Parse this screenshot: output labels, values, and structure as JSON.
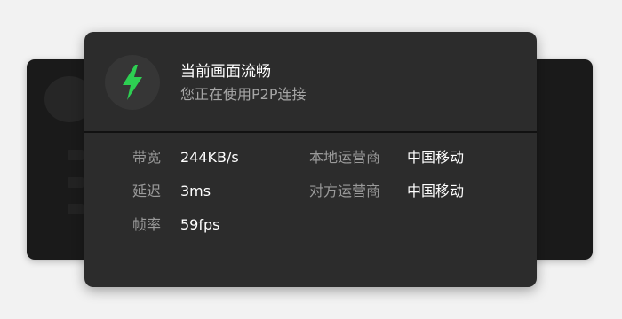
{
  "status": {
    "icon": "lightning-bolt-icon",
    "icon_color": "#2dcf52",
    "title": "当前画面流畅",
    "subtitle": "您正在使用P2P连接"
  },
  "stats": {
    "bandwidth": {
      "label": "带宽",
      "value": "244KB/s"
    },
    "latency": {
      "label": "延迟",
      "value": "3ms"
    },
    "framerate": {
      "label": "帧率",
      "value": "59fps"
    },
    "local_carrier": {
      "label": "本地运营商",
      "value": "中国移动"
    },
    "remote_carrier": {
      "label": "对方运营商",
      "value": "中国移动"
    }
  }
}
